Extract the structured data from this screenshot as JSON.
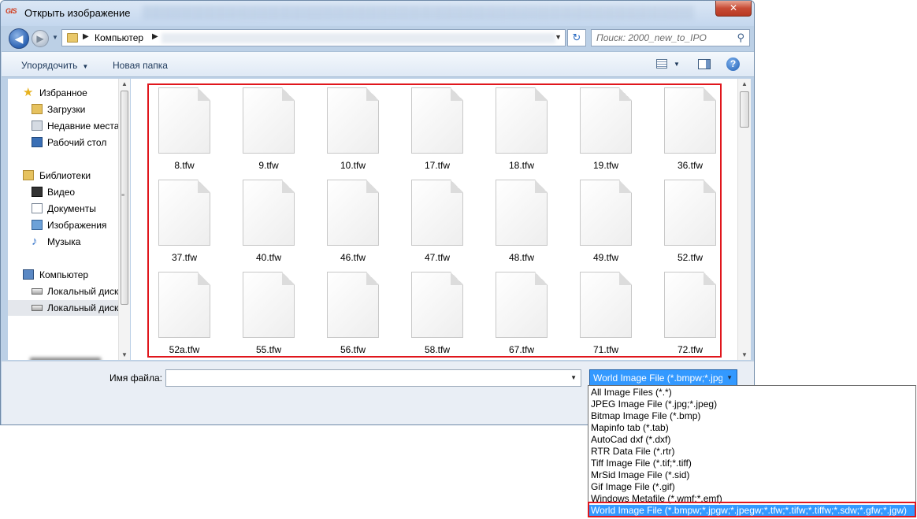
{
  "window": {
    "app_icon_text": "GIS",
    "title": "Открыть изображение",
    "close_glyph": "✕"
  },
  "address_bar": {
    "crumb": "Компьютер",
    "search_placeholder": "Поиск: 2000_new_to_IPO"
  },
  "toolbar": {
    "organize_label": "Упорядочить",
    "new_folder_label": "Новая папка"
  },
  "nav": {
    "items": [
      {
        "label": "Избранное",
        "icon": "star-icon"
      },
      {
        "label": "Загрузки",
        "icon": "downloads-folder-icon"
      },
      {
        "label": "Недавние места",
        "icon": "recent-places-icon"
      },
      {
        "label": "Рабочий стол",
        "icon": "desktop-icon"
      },
      {
        "label": "Библиотеки",
        "icon": "libraries-icon"
      },
      {
        "label": "Видео",
        "icon": "video-icon"
      },
      {
        "label": "Документы",
        "icon": "documents-icon"
      },
      {
        "label": "Изображения",
        "icon": "pictures-icon"
      },
      {
        "label": "Музыка",
        "icon": "music-icon"
      },
      {
        "label": "Компьютер",
        "icon": "computer-icon"
      },
      {
        "label": "Локальный диск",
        "icon": "local-disk-icon"
      },
      {
        "label": "Локальный диск",
        "icon": "local-disk-icon"
      }
    ]
  },
  "files": [
    "8.tfw",
    "9.tfw",
    "10.tfw",
    "17.tfw",
    "18.tfw",
    "19.tfw",
    "36.tfw",
    "37.tfw",
    "40.tfw",
    "46.tfw",
    "47.tfw",
    "48.tfw",
    "49.tfw",
    "52.tfw",
    "52a.tfw",
    "55.tfw",
    "56.tfw",
    "58.tfw",
    "67.tfw",
    "71.tfw",
    "72.tfw"
  ],
  "bottom": {
    "filename_label": "Имя файла:",
    "filename_value": "",
    "filter_selected": "World Image File (*.bmpw;*.jpgw;*.jpegw;*.tfw;*.tifw;*.tiffw;*.sdw;*.gfw;*.jgw)"
  },
  "filter_options": [
    "All Image Files (*.*)",
    "JPEG Image File (*.jpg;*.jpeg)",
    "Bitmap Image File (*.bmp)",
    "Mapinfo tab (*.tab)",
    "AutoCad dxf (*.dxf)",
    "RTR Data File (*.rtr)",
    "Tiff Image File (*.tif;*.tiff)",
    "MrSid Image File (*.sid)",
    "Gif Image File (*.gif)",
    "Windows Metafile (*.wmf;*.emf)",
    "World Image File (*.bmpw;*.jpgw;*.jpegw;*.tfw;*.tifw;*.tiffw;*.sdw;*.gfw;*.jgw)"
  ],
  "colors": {
    "highlight_border": "#e0161c",
    "selection": "#3399ff"
  }
}
